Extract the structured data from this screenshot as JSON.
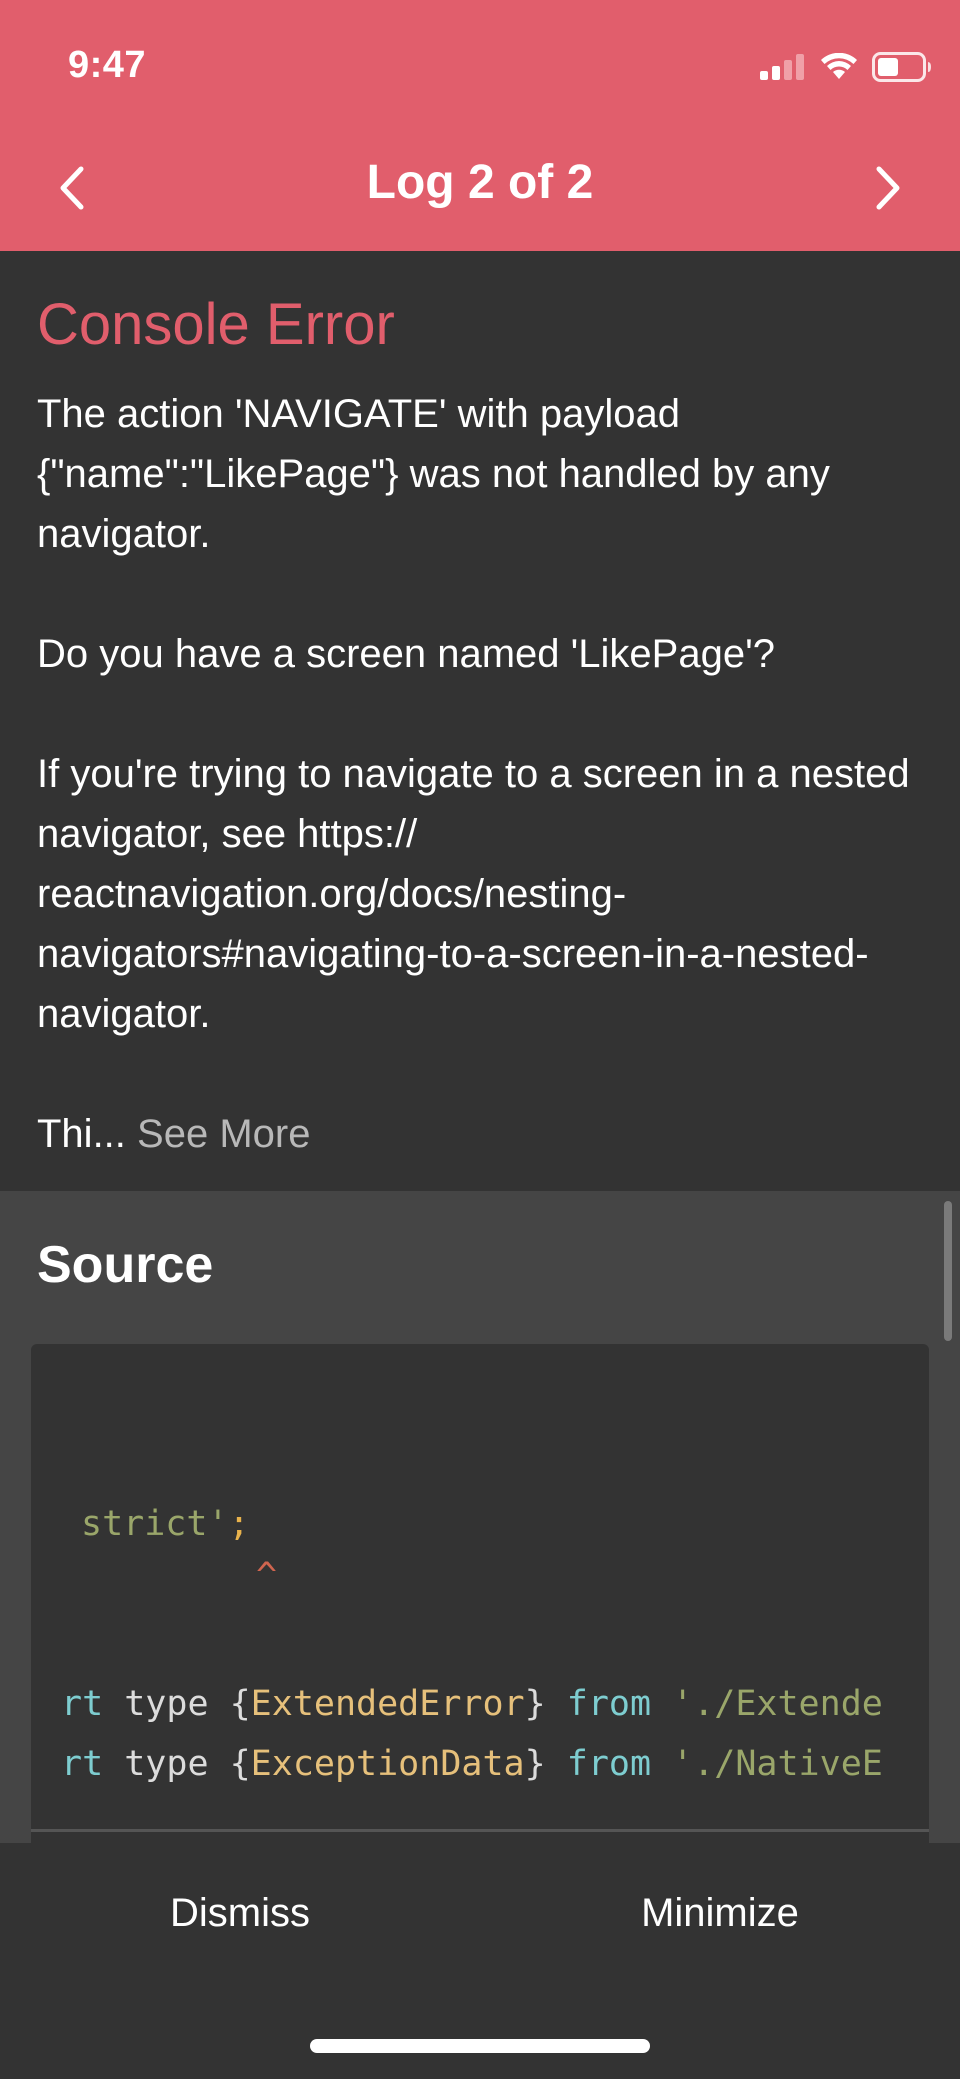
{
  "status_bar": {
    "time": "9:47"
  },
  "header": {
    "title": "Log 2 of 2",
    "prev_icon": "chevron-left-icon",
    "next_icon": "chevron-right-icon",
    "accent_color": "#E15E6C"
  },
  "message": {
    "heading": "Console Error",
    "paragraph1": "The action 'NAVIGATE' with payload {\"name\":\"LikePage\"} was not handled by any navigator.",
    "paragraph2": "Do you have a screen named 'LikePage'?",
    "paragraph3": "If you're trying to navigate to a screen in a nested navigator, see https:// reactnavigation.org/docs/nesting-navigators#navigating-to-a-screen-in-a-nested-navigator.",
    "truncated": "Thi...",
    "see_more": "See More"
  },
  "source": {
    "heading": "Source",
    "line1": {
      "string": "strict'",
      "punct": ";"
    },
    "caret": "^",
    "line2": {
      "kw1": "rt",
      "plain1": " type ",
      "brace_open": "{",
      "type": "ExtendedError",
      "brace_close": "}",
      "kw2": " from ",
      "string": "'./Extende"
    },
    "line3": {
      "kw1": "rt",
      "plain1": " type ",
      "brace_open": "{",
      "type": "ExceptionData",
      "brace_close": "}",
      "kw2": " from ",
      "string": "'./NativeE"
    }
  },
  "footer": {
    "dismiss_label": "Dismiss",
    "minimize_label": "Minimize"
  }
}
